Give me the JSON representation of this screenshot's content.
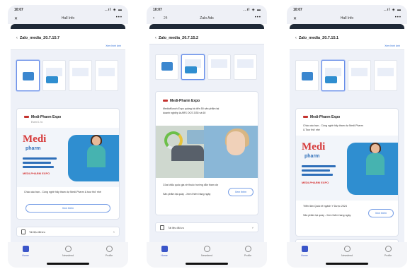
{
  "status": {
    "time": "10:07",
    "signal": "..ıl ◈ ▬"
  },
  "screens": [
    {
      "topbar_title": "Hall Info",
      "file_name": "Zalo_media_20.7.15.7",
      "link": "Xem hình ảnh",
      "card": {
        "brand": "Medi-Pharm Expo",
        "subtitle": "Event 1 hr.",
        "banner_logo": "Medi",
        "banner_logo2": "pharm",
        "banner_red": "MEDI-PHARM EXPO",
        "desc": "Chào các bạn - Cùng nghề hãy tham dự Medi-Pharm & tour thử nhé",
        "button": "Xem thêm"
      },
      "bottom_label": "Tài liệu đã lưu",
      "nav": [
        "Home",
        "Newsfeed",
        "Profile"
      ]
    },
    {
      "back": "24",
      "topbar_title": "Zalo Ads",
      "file_name": "Zalo_media_20.7.15.2",
      "card": {
        "brand": "Medi-Pharm Expo",
        "desc1": "MediaMunch Expo quảng bá đến 50 sản phẩm tại",
        "desc2": "doanh nghiệp là ARS OCS 3/35 và 60",
        "cta1": "Cửa khẩu quốc gia về thuốc hướng dẫn tham dự",
        "cta2": "Sản phẩm tại quầy - Xem thêm hàng ngày",
        "button": "Xem thêm"
      },
      "bottom_label": "Tài liệu đã lưu",
      "nav": [
        "Home",
        "Newsfeed",
        "Profile"
      ]
    },
    {
      "topbar_title": "Hall Info",
      "file_name": "Zalo_media_20.7.15.1",
      "link": "Xem hình ảnh",
      "card": {
        "brand": "Medi-Pharm Expo",
        "desc1": "Chào các bạn - Cùng nghề hãy tham dự Medi-Pharm",
        "desc2": "& Tour thử nhé",
        "banner_logo": "Medi",
        "banner_logo2": "pharm",
        "banner_red": "MEDI-PHARM EXPO",
        "cta1": "Triển lãm Quốc tế ngành Y Dược 2024",
        "cta2": "Sản phẩm tại quầy - Xem thêm hàng ngày",
        "button": "Xem thêm"
      },
      "bottom_label": "Tài liệu đã lưu",
      "nav": [
        "Home",
        "Newsfeed",
        "Profile"
      ]
    }
  ]
}
